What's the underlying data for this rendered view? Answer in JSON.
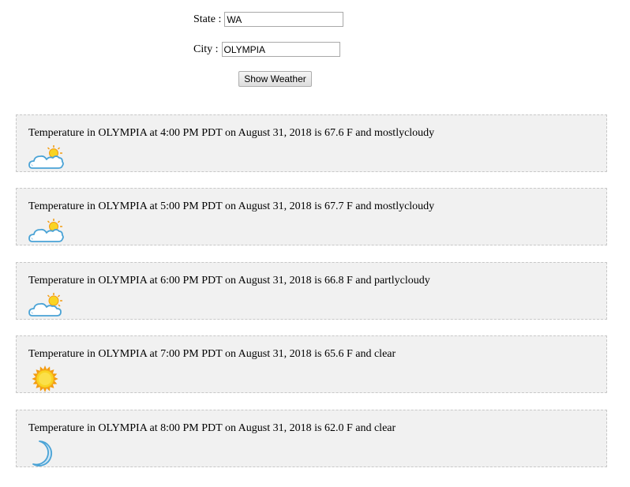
{
  "form": {
    "state_label": "State :",
    "state_value": "WA",
    "city_label": "City :",
    "city_value": "OLYMPIA",
    "submit_label": "Show Weather"
  },
  "forecasts": [
    {
      "text": "Temperature in OLYMPIA at 4:00 PM PDT on August 31, 2018 is 67.6 F and mostlycloudy",
      "icon": "mostlycloudy-icon"
    },
    {
      "text": "Temperature in OLYMPIA at 5:00 PM PDT on August 31, 2018 is 67.7 F and mostlycloudy",
      "icon": "mostlycloudy-icon"
    },
    {
      "text": "Temperature in OLYMPIA at 6:00 PM PDT on August 31, 2018 is 66.8 F and partlycloudy",
      "icon": "partlycloudy-icon"
    },
    {
      "text": "Temperature in OLYMPIA at 7:00 PM PDT on August 31, 2018 is 65.6 F and clear",
      "icon": "sun-icon"
    },
    {
      "text": "Temperature in OLYMPIA at 8:00 PM PDT on August 31, 2018 is 62.0 F and clear",
      "icon": "moon-icon"
    }
  ],
  "colors": {
    "card_background": "#f1f1f1",
    "card_border": "#c8c8c8",
    "sun_fill": "#f9d423",
    "sun_ray": "#f39c12",
    "cloud_outline": "#4aa3d6",
    "moon_fill": "#cfe6f5"
  }
}
